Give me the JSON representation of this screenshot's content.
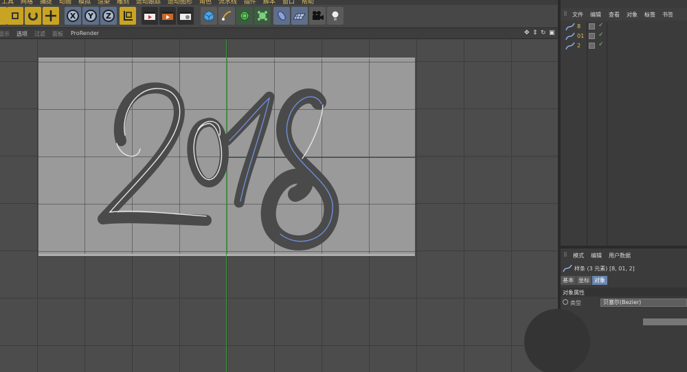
{
  "menubar": {
    "items": [
      "工具",
      "网格",
      "捕捉",
      "动画",
      "模拟",
      "渲染",
      "雕刻",
      "运动跟踪",
      "运动图形",
      "角色",
      "流水线",
      "插件",
      "脚本",
      "窗口",
      "帮助"
    ]
  },
  "toolbar": {
    "groups": [
      {
        "name": "selection-tools",
        "icons": [
          "live-select-icon",
          "move-icon",
          "rotate-icon",
          "scale-icon"
        ]
      },
      {
        "name": "axis-locks",
        "labels": [
          "X",
          "Y",
          "Z"
        ]
      },
      {
        "name": "render",
        "icons": [
          "render-view-icon",
          "render-picture-queue-icon",
          "render-settings-icon"
        ]
      },
      {
        "name": "objects",
        "icons": [
          "cube-icon",
          "pen-spline-icon",
          "subdivision-icon",
          "cloner-icon",
          "deformer-icon",
          "floor-icon",
          "camera-icon",
          "light-icon"
        ]
      }
    ]
  },
  "viewport": {
    "menu": [
      "显示",
      "选项",
      "过滤",
      "面板",
      "ProRender"
    ],
    "corner_icons": [
      "move-view-icon",
      "zoom-view-icon",
      "rotate-view-icon",
      "maximize-view-icon"
    ]
  },
  "object_manager": {
    "menu": [
      "文件",
      "编辑",
      "查看",
      "对象",
      "标签",
      "书签"
    ],
    "active_menu": "标签",
    "objects": [
      {
        "name": "8"
      },
      {
        "name": "01"
      },
      {
        "name": "2"
      }
    ]
  },
  "attribute_manager": {
    "menu": [
      "模式",
      "编辑",
      "用户数据"
    ],
    "object_line": "样条 (3 元素) [8, 01, 2]",
    "tabs": [
      "基本",
      "坐标",
      "对象"
    ],
    "active_tab": "对象",
    "section_title": "对象属性",
    "type_label": "类型",
    "type_value": "贝塞尔(Bezier)"
  },
  "colors": {
    "accent_yellow": "#c9a422",
    "axis_green": "#3a9a3a",
    "axis_red": "#8a2a2a",
    "spline_white": "#e8e8e8",
    "spline_blue": "#6f8fd8",
    "lettering": "#4a4a4a",
    "object_name": "#e8c04a"
  }
}
